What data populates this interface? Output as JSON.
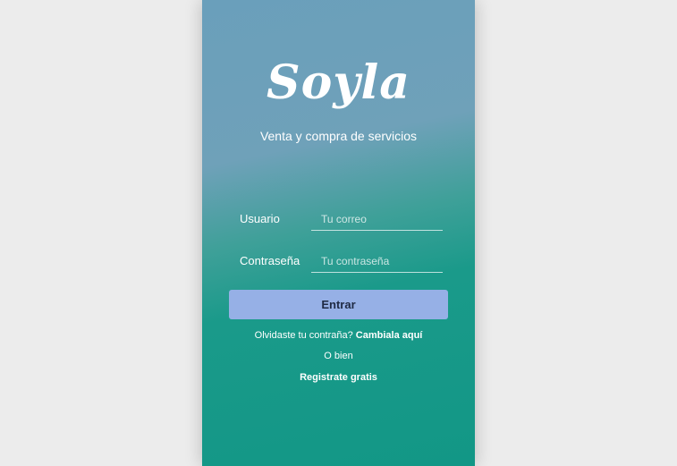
{
  "brand": {
    "logo": "Soyla",
    "tagline": "Venta y compra de servicios"
  },
  "login": {
    "username_label": "Usuario",
    "username_placeholder": "Tu correo",
    "username_value": "",
    "password_label": "Contraseña",
    "password_placeholder": "Tu contraseña",
    "password_value": "",
    "submit_label": "Entrar"
  },
  "links": {
    "forgot_prefix": "Olvidaste tu contraña?",
    "forgot_link": "Cambiala aquí",
    "separator": "O bien",
    "register": "Registrate gratis"
  },
  "colors": {
    "gradient_top": "#6a9fbb",
    "gradient_bottom": "#129786",
    "button_bg": "#96b0e6",
    "page_bg": "#ececec"
  }
}
